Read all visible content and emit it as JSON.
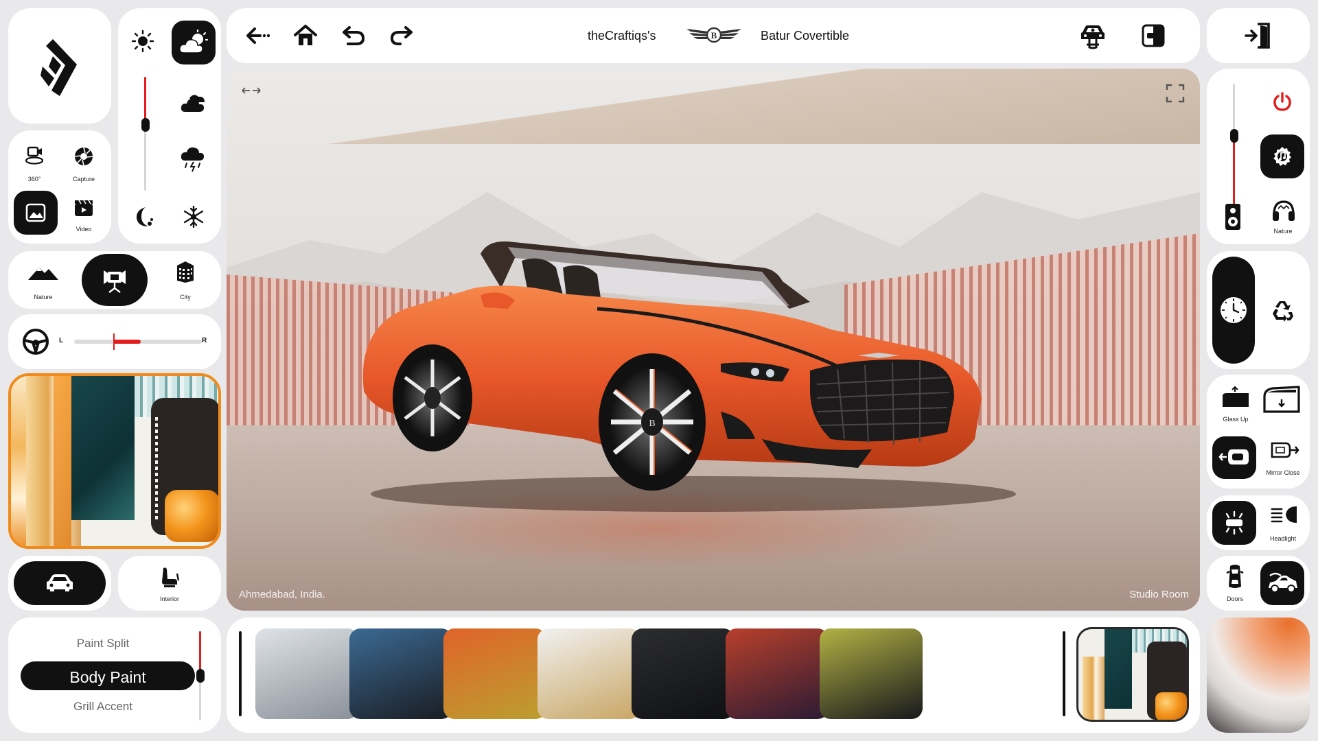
{
  "header": {
    "owner": "theCraftiqs's",
    "model": "Batur Covertible",
    "back_icon": "arrow-back-icon",
    "home_icon": "home-icon",
    "undo_icon": "undo-icon",
    "redo_icon": "redo-icon",
    "brand_logo": "bentley-wings-logo",
    "driver_icon": "car-driver-icon",
    "toggle_icon": "split-toggle-icon",
    "exit_icon": "exit-door-icon"
  },
  "media": {
    "view360_label": "360°",
    "capture_label": "Capture",
    "video_label": "Video",
    "photo_icon": "image-icon"
  },
  "weather": {
    "brightness_level": 0.58,
    "icons": [
      "sun-icon",
      "partly-cloudy-icon",
      "clouds-icon",
      "storm-icon",
      "moon-icon",
      "snowflake-icon"
    ],
    "selected": "partly-cloudy-icon"
  },
  "environment": {
    "nature_label": "Nature",
    "studio_icon": "studio-light-icon",
    "city_label": "City",
    "selected": "studio"
  },
  "steering": {
    "left_label": "L",
    "right_label": "R",
    "position": 0.24
  },
  "vehicle_view": {
    "exterior_icon": "car-front-icon",
    "interior_label": "Interior"
  },
  "paint": {
    "options": [
      "Paint Split",
      "Body Paint",
      "Grill Accent"
    ],
    "selected": "Body Paint",
    "intensity": 0.5
  },
  "viewport": {
    "location": "Ahmedabad, India.",
    "scene": "Studio Room",
    "pan_icon": "pan-arrows-icon",
    "fullscreen_icon": "fullscreen-icon"
  },
  "audio": {
    "volume_level": 0.62,
    "power_icon": "power-icon",
    "music_icon": "music-note-icon",
    "speaker_icon": "speaker-icon",
    "nature_label": "Nature"
  },
  "climate": {
    "mode_icon": "clock-dial-icon",
    "recycle_icon": "recirculation-icon"
  },
  "windows": {
    "glass_up_label": "Glass Up",
    "glass_down_icon": "window-down-icon",
    "mirror_open_icon": "mirror-open-icon",
    "mirror_close_label": "Mirror Close"
  },
  "lights": {
    "interior_light_icon": "cabin-light-icon",
    "headlight_label": "Headlight"
  },
  "doors": {
    "doors_label": "Doors",
    "roof_icon": "convertible-roof-icon"
  },
  "swatches": {
    "colors": [
      [
        "#dfe3e7",
        "#8a9099"
      ],
      [
        "#3b6a93",
        "#1a1c22"
      ],
      [
        "#e0632a",
        "#bb9f2f"
      ],
      [
        "#f1f1f1",
        "#c9a664"
      ],
      [
        "#2c2d31",
        "#0f1012"
      ],
      [
        "#b8402b",
        "#2a1a34"
      ],
      [
        "#b3b245",
        "#17181c"
      ]
    ],
    "selected_index": 7
  },
  "accent_color": "#e11d1d",
  "orange_color": "#f4711f"
}
